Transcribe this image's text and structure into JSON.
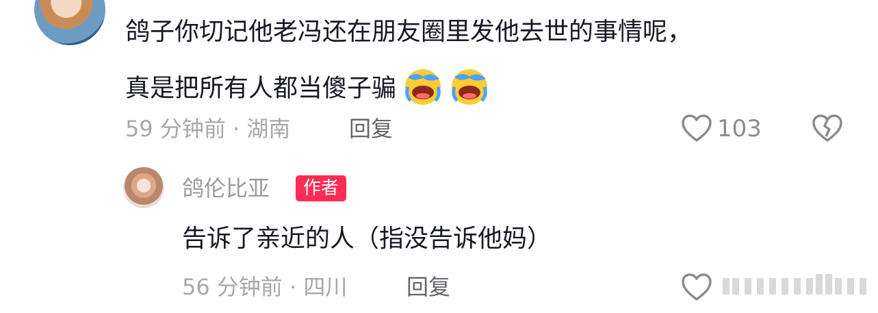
{
  "comment": {
    "text_line1": "鸽子你切记他老冯还在朋友圈里发他去世的事情呢，",
    "text_line2": "真是把所有人都当傻子骗",
    "emoji": "crying-laughing",
    "time_location": "59 分钟前 · 湖南",
    "reply_label": "回复",
    "like_count": "103"
  },
  "reply": {
    "username": "鸽伦比亚",
    "badge": "作者",
    "text": "告诉了亲近的人（指没告诉他妈）",
    "time_location": "56 分钟前 · 四川",
    "reply_label": "回复"
  },
  "colors": {
    "badge": "#fe2c55",
    "emoji_face": "#ffcc33"
  }
}
